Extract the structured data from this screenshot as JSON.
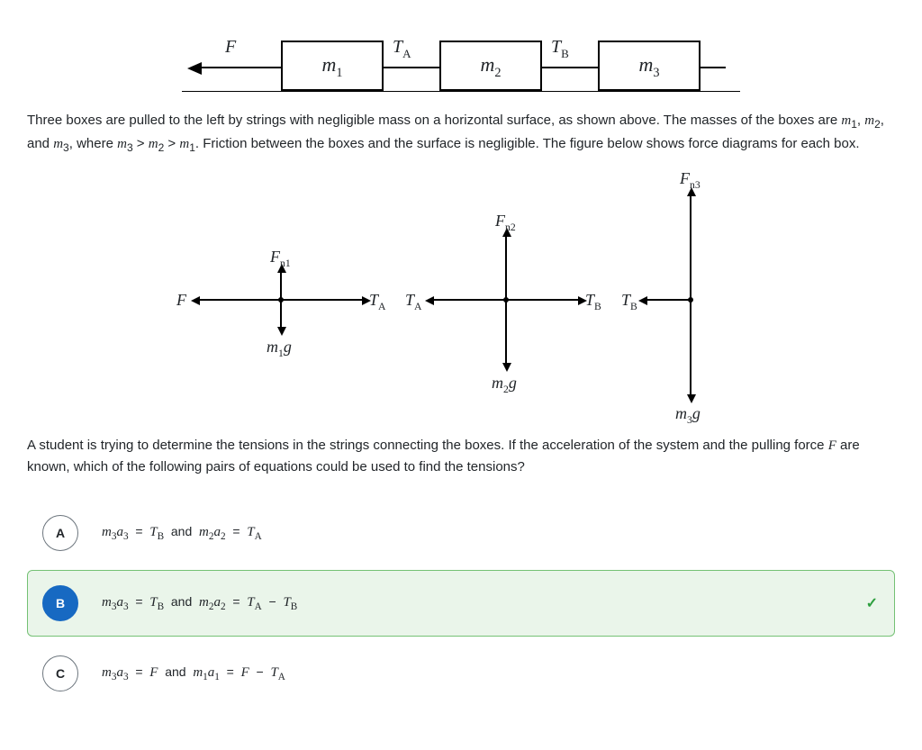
{
  "figure_top": {
    "force_label": "F",
    "tension_a": "T",
    "tension_a_sub": "A",
    "tension_b": "T",
    "tension_b_sub": "B",
    "box1": "m",
    "box1_sub": "1",
    "box2": "m",
    "box2_sub": "2",
    "box3": "m",
    "box3_sub": "3"
  },
  "paragraph1_parts": {
    "p1": "Three boxes are pulled to the left by strings with negligible mass on a horizontal surface, as shown above. The masses of the boxes are ",
    "m1": "m",
    "m1s": "1",
    "c1": ", ",
    "m2": "m",
    "m2s": "2",
    "c2": ", and ",
    "m3": "m",
    "m3s": "3",
    "c3": ", where ",
    "ineq_m3": "m",
    "ineq_m3s": "3",
    "gt1": " > ",
    "ineq_m2": "m",
    "ineq_m2s": "2",
    "gt2": " > ",
    "ineq_m1": "m",
    "ineq_m1s": "1",
    "p2": ". Friction between the boxes and the surface is negligible. The figure below shows force diagrams for each box."
  },
  "force_diagram": {
    "f": "F",
    "fn1": "F",
    "fn1s": "n1",
    "fn2": "F",
    "fn2s": "n2",
    "fn3": "F",
    "fn3s": "n3",
    "ta": "T",
    "tas": "A",
    "tb": "T",
    "tbs": "B",
    "m1g_m": "m",
    "m1g_s": "1",
    "m1g_g": "g",
    "m2g_m": "m",
    "m2g_s": "2",
    "m2g_g": "g",
    "m3g_m": "m",
    "m3g_s": "3",
    "m3g_g": "g"
  },
  "paragraph2_parts": {
    "p1": "A student is trying to determine the tensions in the strings connecting the boxes. If the acceleration of the system and the pulling force ",
    "F": "F",
    "p2": " are known, which of the following pairs of equations could be used to find the tensions?"
  },
  "choices": {
    "a": {
      "letter": "A",
      "eq1_lhs": "m₃a₃",
      "eq1_rhs": "T_B",
      "and": "and",
      "eq2_lhs": "m₂a₂",
      "eq2_rhs": "T_A"
    },
    "b": {
      "letter": "B",
      "eq1_lhs": "m₃a₃",
      "eq1_rhs": "T_B",
      "and": "and",
      "eq2_lhs": "m₂a₂",
      "eq2_rhs": "T_A − T_B"
    },
    "c": {
      "letter": "C",
      "eq1_lhs": "m₃a₃",
      "eq1_rhs": "F",
      "and": "and",
      "eq2_lhs": "m₁a₁",
      "eq2_rhs": "F − T_A"
    }
  },
  "correct_choice": "b",
  "check_icon": "✓",
  "chart_data": {
    "type": "diagram",
    "description": "Physics free-body diagrams for three boxes connected by strings, pulled left by force F. Tensions T_A between boxes 1 and 2, T_B between boxes 2 and 3. Normal forces F_n1, F_n2, F_n3 up; weights m1g, m2g, m3g down. Relative arrow lengths indicate m3 > m2 > m1."
  }
}
